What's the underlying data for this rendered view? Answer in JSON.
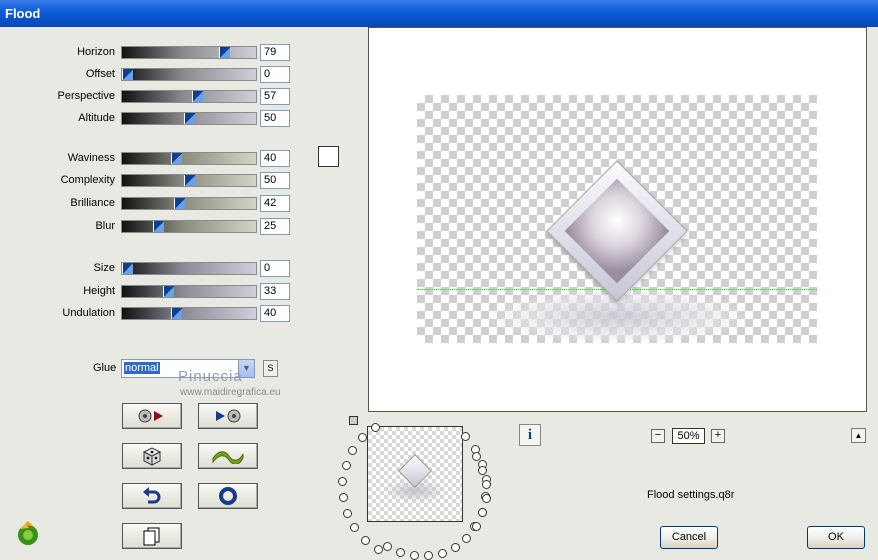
{
  "window": {
    "title": "Flood"
  },
  "sliders": [
    {
      "id": "horizon",
      "label": "Horizon",
      "value": "79",
      "fraction": 0.79,
      "grad": "g1"
    },
    {
      "id": "offset",
      "label": "Offset",
      "value": "0",
      "fraction": 0.0,
      "grad": "g1"
    },
    {
      "id": "perspective",
      "label": "Perspective",
      "value": "57",
      "fraction": 0.57,
      "grad": "g1"
    },
    {
      "id": "altitude",
      "label": "Altitude",
      "value": "50",
      "fraction": 0.5,
      "grad": "g1"
    },
    {
      "id": "waviness",
      "label": "Waviness",
      "value": "40",
      "fraction": 0.4,
      "grad": "g2"
    },
    {
      "id": "complexity",
      "label": "Complexity",
      "value": "50",
      "fraction": 0.5,
      "grad": "g2"
    },
    {
      "id": "brilliance",
      "label": "Brilliance",
      "value": "42",
      "fraction": 0.42,
      "grad": "g2"
    },
    {
      "id": "blur",
      "label": "Blur",
      "value": "25",
      "fraction": 0.25,
      "grad": "g2"
    },
    {
      "id": "size",
      "label": "Size",
      "value": "0",
      "fraction": 0.0,
      "grad": "g3"
    },
    {
      "id": "height",
      "label": "Height",
      "value": "33",
      "fraction": 0.33,
      "grad": "g3"
    },
    {
      "id": "undulation",
      "label": "Undulation",
      "value": "40",
      "fraction": 0.4,
      "grad": "g3"
    }
  ],
  "glue": {
    "label": "Glue",
    "value": "normal",
    "s_button": "S"
  },
  "watermark": {
    "line1": "Pinuccia",
    "line2": "www.maidiregrafica.eu"
  },
  "zoom": {
    "value": "50%",
    "minus": "−",
    "plus": "+"
  },
  "info_icon": "i",
  "settings_file": "Flood settings.q8r",
  "buttons": {
    "cancel": "Cancel",
    "ok": "OK"
  },
  "colors": {
    "titlebar": "#0a5ad8",
    "swatch": "#ffffff",
    "horizon_line": "#33cc33"
  }
}
